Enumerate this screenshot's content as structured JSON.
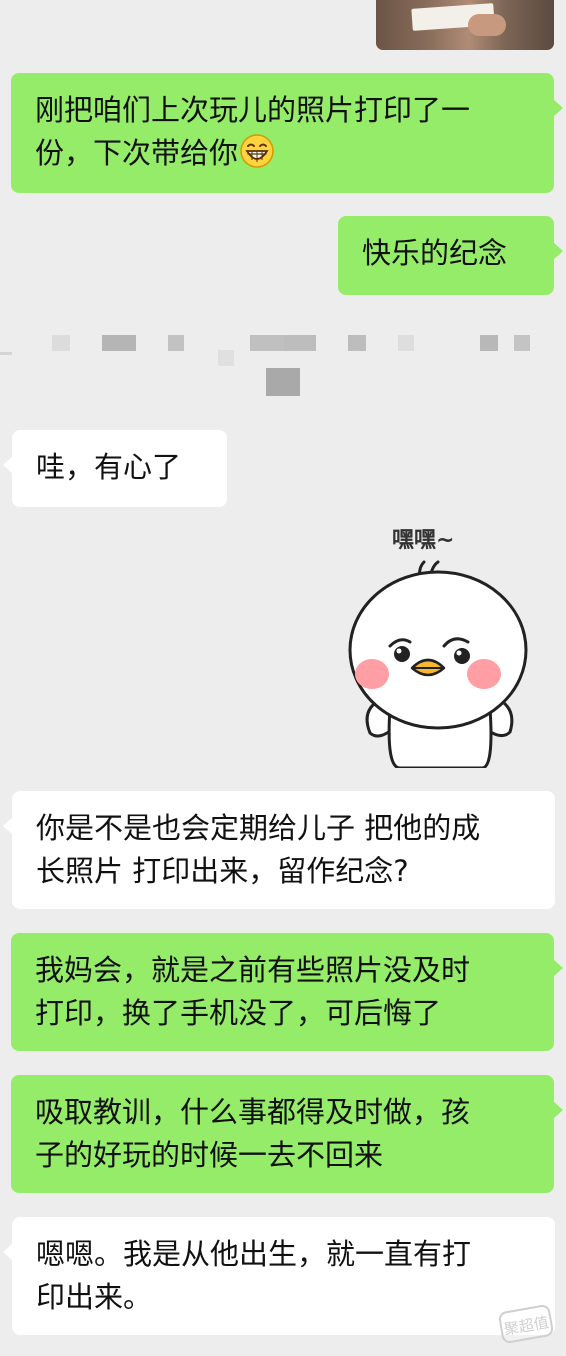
{
  "messages": [
    {
      "id": "m1",
      "side": "out",
      "lines": [
        "刚把咱们上次玩儿的照片打印了一",
        "份，下次带给你"
      ],
      "emoji": "grinning-face-emoji"
    },
    {
      "id": "m2",
      "side": "out",
      "lines": [
        "快乐的纪念"
      ]
    },
    {
      "id": "m3",
      "side": "in",
      "lines": [
        "哇，有心了"
      ]
    },
    {
      "id": "m4",
      "side": "in",
      "type": "sticker",
      "sticker_text": "嘿嘿~"
    },
    {
      "id": "m5",
      "side": "in",
      "lines": [
        "你是不是也会定期给儿子 把他的成",
        "长照片 打印出来，留作纪念?"
      ]
    },
    {
      "id": "m6",
      "side": "out",
      "lines": [
        "我妈会，就是之前有些照片没及时",
        "打印，换了手机没了，可后悔了"
      ]
    },
    {
      "id": "m7",
      "side": "out",
      "lines": [
        "吸取教训，什么事都得及时做，孩",
        "子的好玩的时候一去不回来"
      ]
    },
    {
      "id": "m8",
      "side": "in",
      "lines": [
        "嗯嗯。我是从他出生，就一直有打",
        "印出来。"
      ]
    }
  ],
  "watermark": "聚超值",
  "colors": {
    "background": "#ededed",
    "outgoing_bubble": "#95ec69",
    "incoming_bubble": "#ffffff",
    "text": "#111111"
  }
}
